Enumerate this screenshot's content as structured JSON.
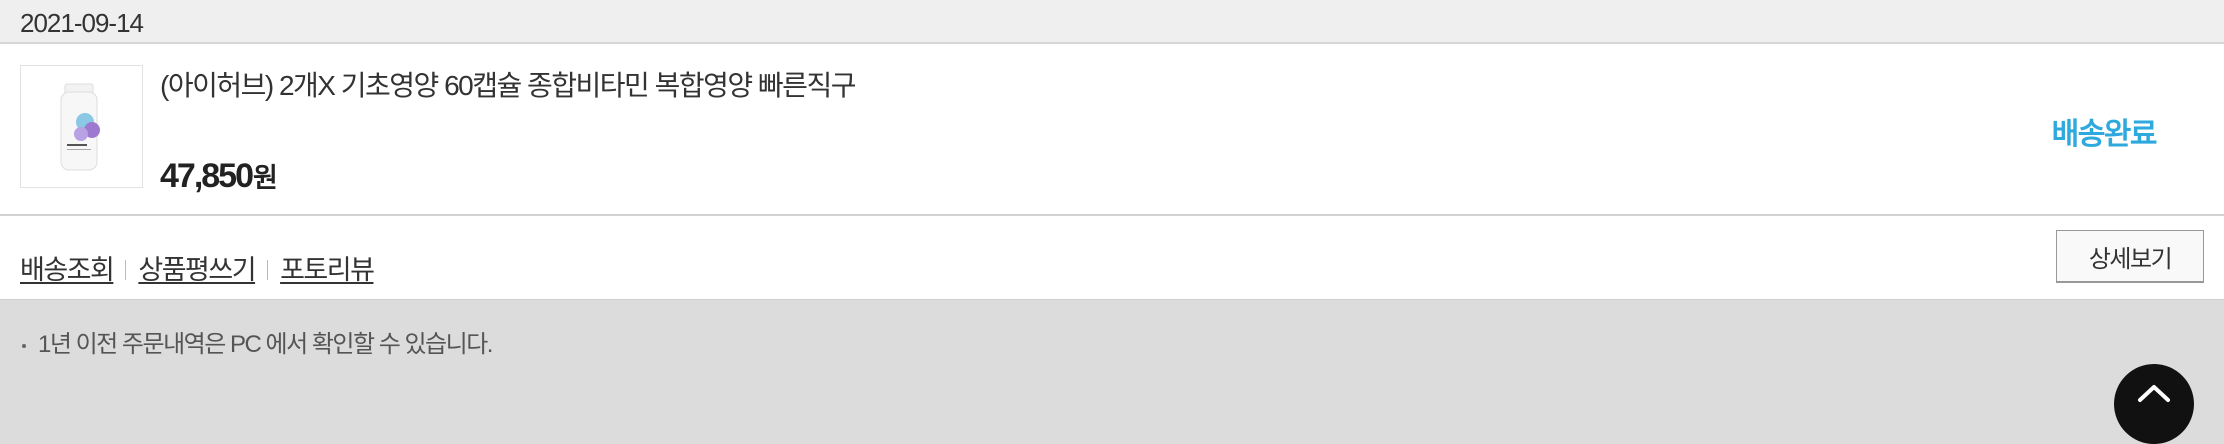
{
  "order_date": "2021-09-14",
  "order": {
    "product_name": "(아이허브) 2개X 기초영양 60캡슐 종합비타민 복합영양 빠른직구",
    "price": "47,850",
    "price_unit": "원",
    "status": "배송완료",
    "status_color": "#2ea9de"
  },
  "actions": {
    "track_shipping": "배송조회",
    "write_review": "상품평쓰기",
    "photo_review": "포토리뷰",
    "detail_button": "상세보기"
  },
  "notice": "1년 이전 주문내역은 PC 에서 확인할 수 있습니다.",
  "icons": {
    "product": "product-bottle-image",
    "scroll_top": "chevron-up-icon"
  }
}
